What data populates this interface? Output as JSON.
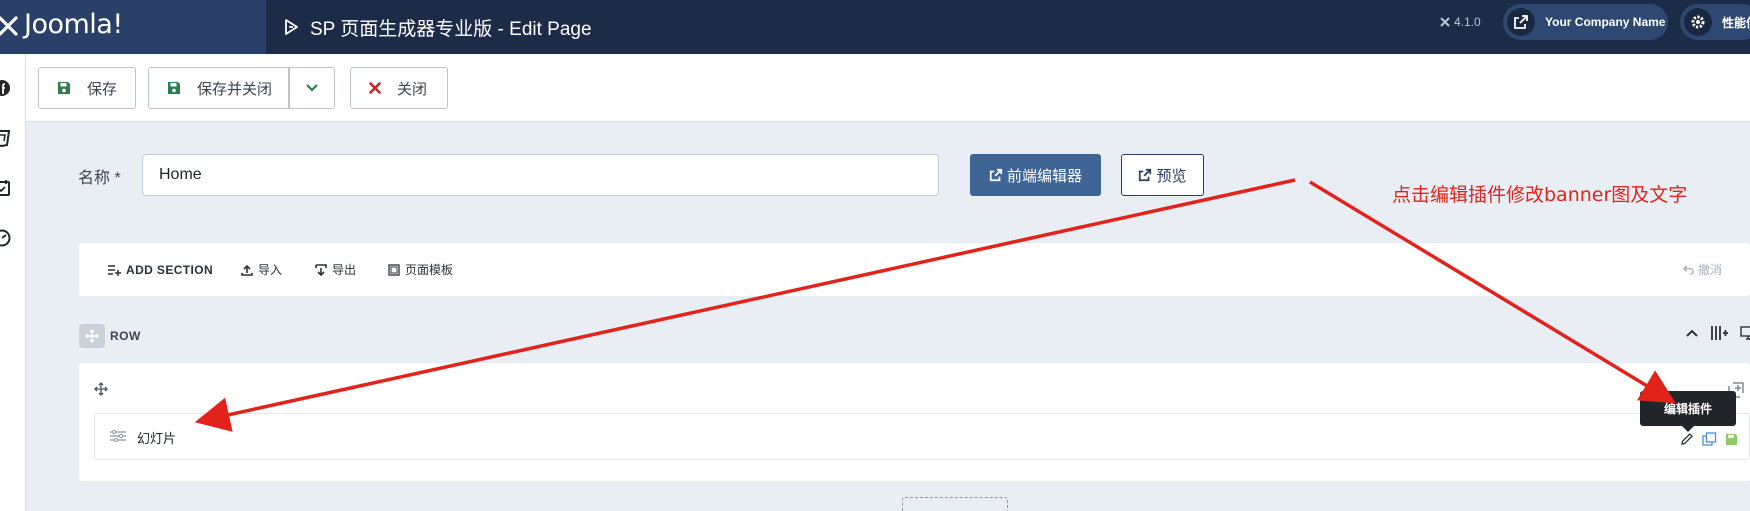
{
  "header": {
    "brand": "Joomla!",
    "page_title": "SP 页面生成器专业版 - Edit Page",
    "version": "4.1.0",
    "company_name": "Your Company Name",
    "performance_label": "性能信"
  },
  "toolbar": {
    "save_label": "保存",
    "save_close_label": "保存并关闭",
    "close_label": "关闭"
  },
  "form": {
    "name_label": "名称 *",
    "name_value": "Home",
    "frontend_editor_label": "前端编辑器",
    "preview_label": "预览"
  },
  "builder": {
    "add_section_label": "ADD SECTION",
    "import_label": "导入",
    "export_label": "导出",
    "page_templates_label": "页面模板",
    "undo_label": "撤消",
    "row_label": "ROW",
    "addon_name": "幻灯片",
    "tooltip": "编辑插件"
  },
  "annotation": {
    "text": "点击编辑插件修改banner图及文字",
    "color": "#e3231b"
  },
  "colors": {
    "header_bg": "#1c2c48",
    "brand_bg": "#2a4068",
    "primary_button": "#3f6496",
    "save_icon": "#2e7d4f",
    "close_icon": "#c62828"
  }
}
